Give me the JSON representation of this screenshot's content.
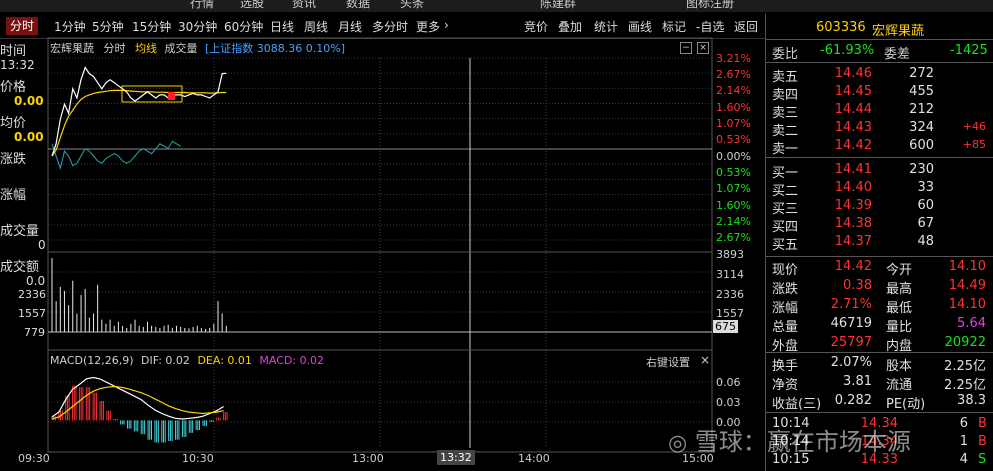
{
  "header": {
    "items": [
      "行情",
      "选股",
      "资讯",
      "数据",
      "头条",
      "陈建群",
      "图标注册"
    ]
  },
  "menu": {
    "periods": [
      "分时",
      "1分钟",
      "5分钟",
      "15分钟",
      "30分钟",
      "60分钟",
      "日线",
      "周线",
      "月线",
      "多分时",
      "更多"
    ],
    "more_arrow": "›",
    "tools": [
      "竞价",
      "叠加",
      "统计",
      "画线",
      "标记",
      "-自选",
      "返回"
    ]
  },
  "chart_header": {
    "stock_name": "宏辉果蔬",
    "tab_intraday": "分时",
    "tab_avg": "均线",
    "tab_volume": "成交量",
    "index_overlay": "[上证指数 3088.36 0.10%]"
  },
  "left_labels": {
    "time_label": "时间",
    "time_value": "13:32",
    "price_label": "价格",
    "price_value": "0.00",
    "avg_label": "均价",
    "avg_value": "0.00",
    "chg_label": "涨跌",
    "amp_label": "涨幅",
    "vol_label": "成交量",
    "vol_value": "0",
    "amt_label": "成交额",
    "amt_value": "0.0"
  },
  "macd": {
    "label": "MACD(12,26,9)",
    "dif": "DIF: 0.02",
    "dea": "DEA: 0.01",
    "macd": "MACD: 0.02",
    "settings": "右键设置",
    "axis": [
      "0.06",
      "0.03",
      "0.00"
    ]
  },
  "chart_data": {
    "type": "line",
    "x_ticks": [
      "09:30",
      "10:30",
      "13:00",
      "13:32",
      "14:00",
      "15:00"
    ],
    "pct_up": [
      "3.21%",
      "2.67%",
      "2.14%",
      "1.60%",
      "1.07%",
      "0.53%"
    ],
    "pct_zero": "0.00%",
    "pct_down": [
      "0.53%",
      "1.07%",
      "1.60%",
      "2.14%",
      "2.67%"
    ],
    "volume_right_ticks": [
      "3893",
      "3114",
      "2336",
      "1557"
    ],
    "volume_left_ticks": [
      "2336",
      "1557",
      "779"
    ],
    "volume_cursor": "675",
    "price_pct": [
      0,
      0.4,
      1.2,
      1.7,
      1.4,
      2.2,
      1.9,
      2.5,
      2.9,
      2.7,
      2.6,
      2.4,
      2.2,
      2.4,
      2.5,
      2.4,
      2.3,
      2.2,
      2.1,
      1.9,
      1.8,
      1.9,
      2.0,
      2.1,
      2.0,
      1.9,
      2.0,
      2.0,
      1.9,
      2.0,
      2.0,
      2.0,
      1.95,
      2.0,
      2.05,
      2.0,
      2.0,
      1.95,
      1.9,
      2.0,
      2.1,
      2.7,
      2.71
    ],
    "avg_pct": [
      0,
      0.2,
      0.6,
      1.0,
      1.3,
      1.5,
      1.7,
      1.85,
      1.95,
      2.0,
      2.05,
      2.08,
      2.1,
      2.12,
      2.14,
      2.15,
      2.15,
      2.15,
      2.14,
      2.13,
      2.12,
      2.11,
      2.1,
      2.1,
      2.1,
      2.09,
      2.09,
      2.09,
      2.08,
      2.08,
      2.08,
      2.08,
      2.08,
      2.07,
      2.07,
      2.07,
      2.07,
      2.07,
      2.06,
      2.06,
      2.07,
      2.08,
      2.08
    ],
    "index_pct": [
      0.05,
      0.0,
      -0.05,
      0.02,
      0.0,
      -0.04,
      -0.03,
      0.0,
      0.03,
      0.02,
      0.0,
      -0.02,
      -0.03,
      -0.01,
      0.0,
      0.01,
      0.0,
      -0.02,
      -0.03,
      -0.02,
      0.0,
      0.02,
      0.03,
      0.02,
      0.01,
      0.03,
      0.05,
      0.04,
      0.03,
      0.06,
      0.05,
      0.04
    ],
    "volume": [
      3600,
      1500,
      2200,
      2000,
      1300,
      2500,
      900,
      1800,
      2100,
      700,
      900,
      2300,
      600,
      400,
      600,
      300,
      500,
      300,
      200,
      400,
      600,
      300,
      250,
      500,
      300,
      250,
      200,
      300,
      350,
      200,
      300,
      250,
      200,
      180,
      250,
      300,
      200,
      150,
      200,
      400,
      1500,
      900,
      300
    ],
    "macd_dif": [
      0.005,
      0.012,
      0.03,
      0.045,
      0.052,
      0.06,
      0.062,
      0.06,
      0.055,
      0.05,
      0.045,
      0.04,
      0.035,
      0.03,
      0.022,
      0.015,
      0.01,
      0.006,
      0.003,
      0.002,
      0.003,
      0.004,
      0.006,
      0.01,
      0.014,
      0.02
    ],
    "macd_dea": [
      0.002,
      0.005,
      0.012,
      0.02,
      0.028,
      0.036,
      0.042,
      0.046,
      0.048,
      0.049,
      0.048,
      0.046,
      0.043,
      0.04,
      0.036,
      0.031,
      0.026,
      0.021,
      0.017,
      0.014,
      0.012,
      0.011,
      0.01,
      0.011,
      0.012,
      0.014
    ],
    "macd_hist": [
      0.006,
      0.014,
      0.036,
      0.05,
      0.048,
      0.048,
      0.04,
      0.028,
      0.014,
      0.002,
      -0.006,
      -0.012,
      -0.016,
      -0.02,
      -0.028,
      -0.032,
      -0.032,
      -0.03,
      -0.028,
      -0.024,
      -0.018,
      -0.014,
      -0.008,
      -0.002,
      0.004,
      0.012
    ],
    "macd_ylim": [
      -0.04,
      0.07
    ]
  },
  "quote": {
    "code": "603336",
    "name": "宏辉果蔬",
    "weibi_label": "委比",
    "weibi_value": "-61.93%",
    "weicha_label": "委差",
    "weicha_value": "-1425",
    "asks": [
      {
        "label": "卖五",
        "price": "14.46",
        "vol": "272",
        "chg": ""
      },
      {
        "label": "卖四",
        "price": "14.45",
        "vol": "455",
        "chg": ""
      },
      {
        "label": "卖三",
        "price": "14.44",
        "vol": "212",
        "chg": ""
      },
      {
        "label": "卖二",
        "price": "14.43",
        "vol": "324",
        "chg": "+46"
      },
      {
        "label": "卖一",
        "price": "14.42",
        "vol": "600",
        "chg": "+85"
      }
    ],
    "bids": [
      {
        "label": "买一",
        "price": "14.41",
        "vol": "230"
      },
      {
        "label": "买二",
        "price": "14.40",
        "vol": "33"
      },
      {
        "label": "买三",
        "price": "14.39",
        "vol": "60"
      },
      {
        "label": "买四",
        "price": "14.38",
        "vol": "67"
      },
      {
        "label": "买五",
        "price": "14.37",
        "vol": "48"
      }
    ],
    "stats": [
      {
        "l1": "现价",
        "v1": "14.42",
        "c1": "red",
        "l2": "今开",
        "v2": "14.10",
        "c2": "red"
      },
      {
        "l1": "涨跌",
        "v1": "0.38",
        "c1": "red",
        "l2": "最高",
        "v2": "14.49",
        "c2": "red"
      },
      {
        "l1": "涨幅",
        "v1": "2.71%",
        "c1": "red",
        "l2": "最低",
        "v2": "14.10",
        "c2": "red"
      },
      {
        "l1": "总量",
        "v1": "46719",
        "c1": "grey",
        "l2": "量比",
        "v2": "5.64",
        "c2": "magenta"
      },
      {
        "l1": "外盘",
        "v1": "25797",
        "c1": "red",
        "l2": "内盘",
        "v2": "20922",
        "c2": "green"
      }
    ],
    "fundamentals": [
      {
        "l1": "换手",
        "v1": "2.07%",
        "l2": "股本",
        "v2": "2.25亿"
      },
      {
        "l1": "净资",
        "v1": "3.81",
        "l2": "流通",
        "v2": "2.25亿"
      },
      {
        "l1": "收益(三)",
        "v1": "0.282",
        "l2": "PE(动)",
        "v2": "38.3"
      }
    ],
    "ticks": [
      {
        "time": "10:14",
        "price": "14.34",
        "vol": "6",
        "side": "B"
      },
      {
        "time": "10:14",
        "price": "14.34",
        "vol": "1",
        "side": "B"
      },
      {
        "time": "10:15",
        "price": "14.33",
        "vol": "4",
        "side": "S"
      }
    ]
  },
  "watermark": "雪球：赢在市场本源",
  "colors": {
    "up": "#ff3232",
    "down": "#14e614",
    "price_line": "#ffffff",
    "avg_line": "#ffd200",
    "accent": "#ffd200"
  }
}
